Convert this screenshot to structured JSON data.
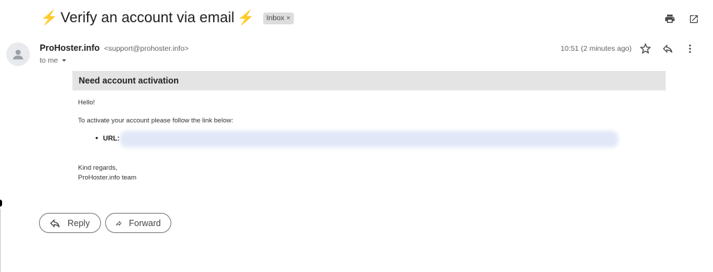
{
  "subject": {
    "icon_left": "⚡",
    "title": "Verify an account via email",
    "icon_right": "⚡",
    "label": "Inbox",
    "label_remove": "×"
  },
  "toolbar": {
    "icons": [
      "print-icon",
      "open-in-new-window-icon"
    ]
  },
  "message": {
    "sender_name": "ProHoster.info",
    "sender_email": "<support@prohoster.info>",
    "to_line": "to me",
    "time": "10:51 (2 minutes ago)",
    "actions": [
      "star-icon",
      "reply-icon",
      "more-options-icon"
    ]
  },
  "body": {
    "header": "Need account activation",
    "greeting": "Hello!",
    "instruction": "To activate your account please follow the link below:",
    "url_label": "URL:",
    "closing": "Kind regards,",
    "signature": "ProHoster.info team"
  },
  "actions": {
    "reply_label": "Reply",
    "forward_label": "Forward"
  }
}
